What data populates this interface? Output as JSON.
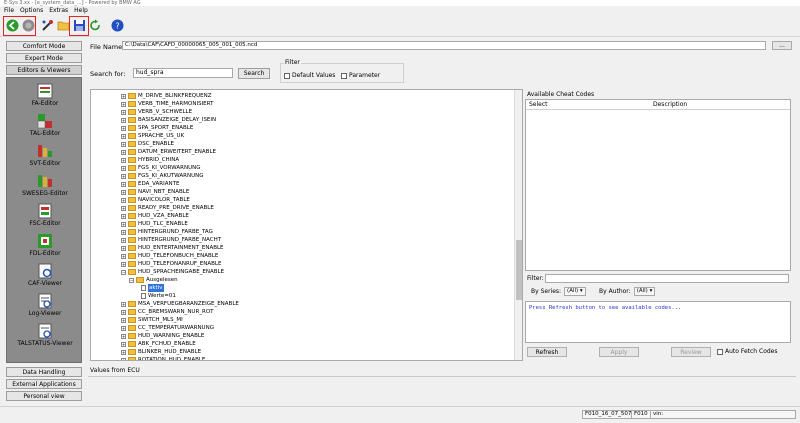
{
  "window": {
    "title": "E-Sys 3.xx - [e_system_data_...]  - Powered by BMW AG"
  },
  "menu": {
    "items": [
      "File",
      "Options",
      "Extras",
      "Help"
    ]
  },
  "toolbar": {
    "buttons": [
      {
        "icon": "connect-icon",
        "color": "#2a9a2a"
      },
      {
        "icon": "disconnect-icon",
        "color": "#888888"
      },
      {
        "icon": "tools-icon",
        "color": "#c03030"
      },
      {
        "icon": "open-folder-icon",
        "color": "#e0b030"
      },
      {
        "icon": "save-icon",
        "color": "#2b4cc0"
      },
      {
        "icon": "refresh-icon",
        "color": "#2a9a2a"
      },
      {
        "icon": "help-icon",
        "color": "#2050c0"
      }
    ]
  },
  "left_panel": {
    "modes": [
      "Comfort Mode",
      "Expert Mode",
      "Editors & Viewers"
    ],
    "editors": [
      "FA-Editor",
      "TAL-Editor",
      "SVT-Editor",
      "SWESEG-Editor",
      "FSC-Editor",
      "FDL-Editor",
      "CAF-Viewer",
      "Log-Viewer",
      "TALSTATUS-Viewer"
    ],
    "bottom": [
      "Data Handling",
      "External Applications",
      "Personal view"
    ]
  },
  "file": {
    "label": "File Name:",
    "value": "C:\\Data\\CAF\\CAFD_00000065_005_001_005.ncd",
    "browse_label": "..."
  },
  "search": {
    "label": "Search for:",
    "value": "hud_spra",
    "button": "Search"
  },
  "filter": {
    "title": "Filter",
    "default_values": "Default Values",
    "parameter": "Parameter"
  },
  "tree": {
    "nodes": [
      "M_DRIVE_BLINKFREQUENZ",
      "VERB_TIME_HARMONISIERT",
      "VERB_V_SCHWELLE",
      "BASISANZEIGE_DELAY_ISEIN",
      "SPA_SPORT_ENABLE",
      "SPRACHE_US_UK",
      "DSC_ENABLE",
      "DATUM_ERWEITERT_ENABLE",
      "HYBRID_CHINA",
      "FGS_KI_VORWARNUNG",
      "FGS_KI_AKUTWARNUNG",
      "EDA_VARIANTE",
      "NAVI_NBT_ENABLE",
      "NAVICOLOR_TABLE",
      "READY_PRE_DRIVE_ENABLE",
      "HUD_VZA_ENABLE",
      "HUD_TLC_ENABLE",
      "HINTERGRUND_FARBE_TAG",
      "HINTERGRUND_FARBE_NACHT",
      "HUD_ENTERTAINMENT_ENABLE",
      "HUD_TELEFONBUCH_ENABLE",
      "HUD_TELEFONANRUF_ENABLE",
      "HUD_SPRACHEINGABE_ENABLE"
    ],
    "expanded_child": "Ausgelesen",
    "selected_leaf": "aktiv",
    "value_leaf": "Werte=01",
    "after_nodes": [
      "MSA_VERFUEGBARANZEIGE_ENABLE",
      "CC_BREMSWARN_NUR_ROT",
      "SWITCH_MLS_MI",
      "CC_TEMPERATURWARNUNG",
      "HUD_WARNING_ENABLE",
      "ABK_FCHUD_ENABLE",
      "BLINKER_HUD_ENABLE",
      "ROTATION_HUD_ENABLE"
    ]
  },
  "cheat": {
    "title": "Available Cheat Codes",
    "col_select": "Select",
    "col_description": "Description",
    "filter_label": "Filter:",
    "by_series_label": "By Series:",
    "by_series_value": "(All)",
    "by_author_label": "By Author:",
    "by_author_value": "(All)",
    "message": "Press Refresh button to see available codes...",
    "refresh": "Refresh",
    "apply": "Apply",
    "review": "Review",
    "auto_fetch": "Auto Fetch Codes"
  },
  "values_from_ecu": "Values from ECU",
  "status": [
    "F010_16_07_507",
    "F010",
    "vin: "
  ]
}
